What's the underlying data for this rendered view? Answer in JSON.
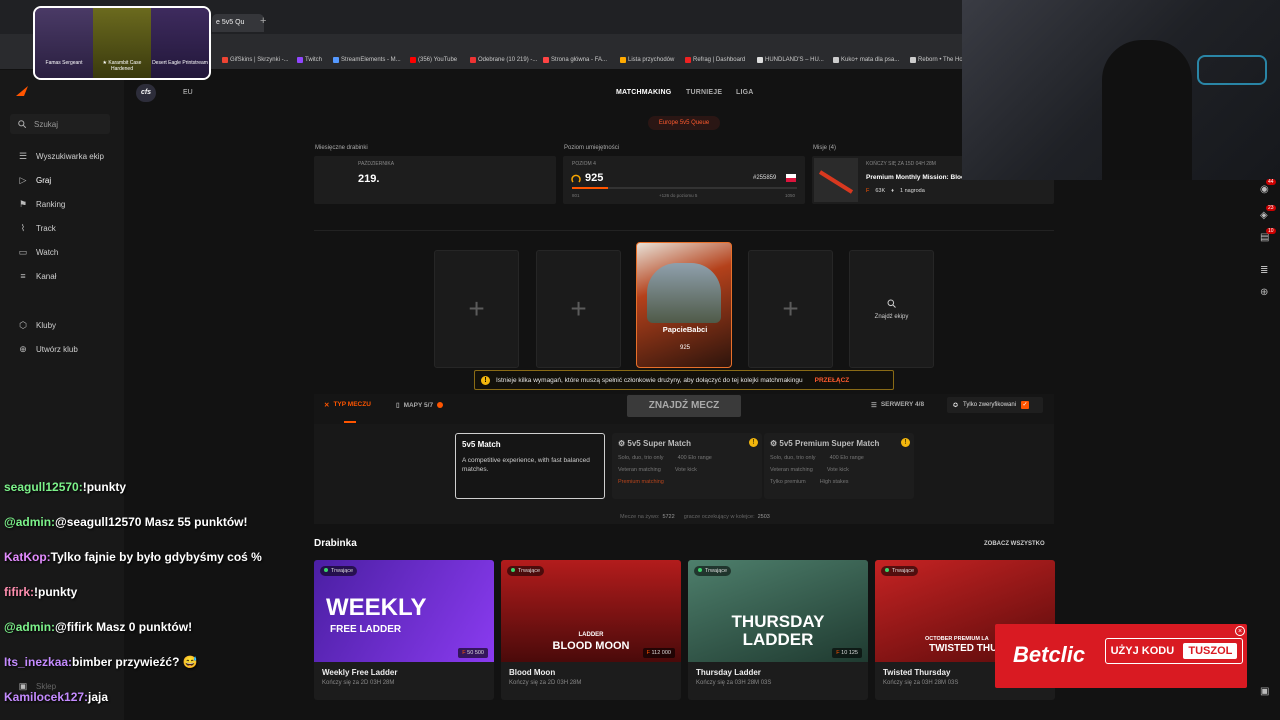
{
  "browser": {
    "tab_title": "e 5v5 Qu",
    "bookmarks": [
      "GifSkins | Skrzynki -...",
      "Twitch",
      "StreamElements - M...",
      "(356) YouTube",
      "Odebrane (10 219) -...",
      "Strona główna - FA...",
      "Lista przychodów",
      "Refrag | Dashboard",
      "HUNDLAND'S – HU...",
      "Kuko+ mata dla psa...",
      "Reborn • The Ho"
    ]
  },
  "sidebar": {
    "search_label": "Szukaj",
    "items": [
      {
        "label": "Wyszukiwarka ekip",
        "icon": "users-icon"
      },
      {
        "label": "Graj",
        "icon": "play-icon"
      },
      {
        "label": "Ranking",
        "icon": "ranking-icon"
      },
      {
        "label": "Track",
        "icon": "track-icon"
      },
      {
        "label": "Watch",
        "icon": "watch-icon"
      },
      {
        "label": "Kanał",
        "icon": "channel-icon"
      }
    ],
    "clubs": [
      {
        "label": "Kluby",
        "icon": "clubs-icon"
      },
      {
        "label": "Utwórz klub",
        "icon": "plus-circle-icon"
      }
    ],
    "bottom_label": "Sklep"
  },
  "header": {
    "game_badge": "cfs",
    "region": "EU",
    "tabs": [
      "MATCHMAKING",
      "TURNIEJE",
      "LIGA"
    ],
    "queue": "Europe 5v5 Queue"
  },
  "stats": {
    "drabinki_label": "Miesięczne drabinki",
    "drabinki_month": "PAŹDZIERNIKA",
    "drabinki_value": "219.",
    "skill_label": "Poziom umiejętności",
    "skill_level": "POZIOM 4",
    "elo": "925",
    "rank": "#255859",
    "elo_min": "801",
    "elo_to_next": "+126 do poziomu 5",
    "elo_max": "1050",
    "missions_label": "Misje (4)",
    "mission_ends": "KOŃCZY SIĘ ZA 15D 04H 28M",
    "mission_title": "Premium Monthly Mission: Blood Moon Boom",
    "mission_reward_points": "63K",
    "mission_reward": "1 nagroda"
  },
  "party": {
    "player_name": "PapcieBabci",
    "player_elo": "925",
    "find_team": "Znajdź ekipy"
  },
  "warning": {
    "text": "Istnieje kilka wymagań, które muszą spełnić członkowie drużyny, aby dołączyć do tej kolejki matchmakingu",
    "action": "PRZEŁĄCZ"
  },
  "filters": {
    "match_type": "TYP MECZU",
    "maps": "MAPY 5/7",
    "find_match": "ZNAJDŹ MECZ",
    "servers": "SERWERY 4/8",
    "verified": "Tylko zweryfikowani"
  },
  "modes": [
    {
      "title": "5v5 Match",
      "desc": "A competitive experience, with fast balanced matches.",
      "tags": []
    },
    {
      "title": "5v5 Super Match",
      "desc": "",
      "tags": [
        "Solo, duo, trio only",
        "400 Elo range",
        "Veteran matching",
        "Vote kick",
        "Premium matching"
      ]
    },
    {
      "title": "5v5 Premium Super Match",
      "desc": "",
      "tags": [
        "Solo, duo, trio only",
        "400 Elo range",
        "Veteran matching",
        "Vote kick",
        "Tylko premium",
        "High stakes"
      ]
    }
  ],
  "online": {
    "matches_label": "Mecze na żywo:",
    "matches": "5722",
    "queue_label": "gracze oczekujący w kolejce:",
    "queue": "2503"
  },
  "ladders": {
    "title": "Drabinka",
    "see_all": "ZOBACZ WSZYSTKO",
    "status": "Trwające",
    "items": [
      {
        "name": "Weekly Free Ladder",
        "ends": "Kończy się za 2D 03H 28M",
        "prize": "50 500",
        "banner1": "WEEKLY",
        "banner2": "FREE LADDER",
        "color": "#6b2bd6"
      },
      {
        "name": "Blood Moon",
        "ends": "Kończy się za 2D 03H 28M",
        "prize": "112 000",
        "banner1": "LADDER",
        "banner2": "BLOOD MOON",
        "color": "#8a1414"
      },
      {
        "name": "Thursday Ladder",
        "ends": "Kończy się za 03H 28M 03S",
        "prize": "10 125",
        "banner1": "THURSDAY",
        "banner2": "LADDER",
        "color": "#2e5a4a"
      },
      {
        "name": "Twisted Thursday",
        "ends": "Kończy się za 03H 28M 03S",
        "prize": "",
        "banner1": "OCTOBER PREMIUM LA",
        "banner2": "TWISTED THURS",
        "color": "#a3181b"
      }
    ]
  },
  "chat": [
    {
      "user": "seagull12570:",
      "msg": "!punkty",
      "color": "#7cf28a"
    },
    {
      "user": "@admin:",
      "msg": "@seagull12570 Masz 55 punktów!",
      "color": "#7cf28a"
    },
    {
      "user": "KatKop:",
      "msg": "Tylko fajnie by było gdybyśmy coś %",
      "color": "#e38cff"
    },
    {
      "user": "fifirk:",
      "msg": "!punkty",
      "color": "#ff8fb0"
    },
    {
      "user": "@admin:",
      "msg": "@fifirk Masz 0 punktów!",
      "color": "#7cf28a"
    },
    {
      "user": "Its_inezkaa:",
      "msg": "bimber przywieźć? 😅",
      "color": "#c48bff"
    },
    {
      "user": "Kamilocek127:",
      "msg": "jaja",
      "color": "#c48bff"
    }
  ],
  "overlay_skins": [
    "Famas Sergeant",
    "★ Karambit Case Hardened",
    "Desert Eagle Printstream"
  ],
  "ad": {
    "brand": "Betclic",
    "cta": "UŻYJ KODU",
    "code": "TUSZOL"
  },
  "rightbar_badges": [
    "44",
    "23",
    "10"
  ]
}
